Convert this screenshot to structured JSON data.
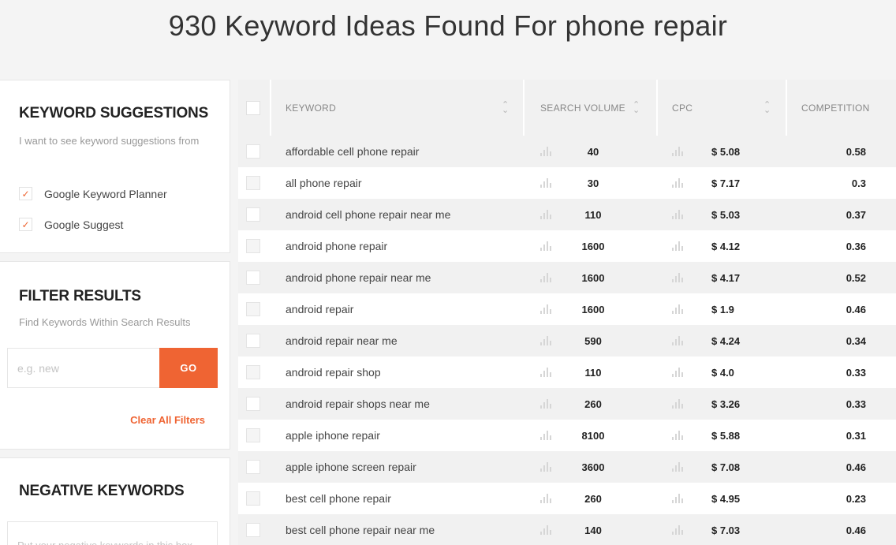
{
  "page": {
    "title": "930 Keyword Ideas Found For phone repair"
  },
  "sidebar": {
    "suggestions": {
      "heading": "KEYWORD SUGGESTIONS",
      "description": "I want to see keyword suggestions from",
      "options": [
        {
          "label": "Google Keyword Planner",
          "checked": true
        },
        {
          "label": "Google Suggest",
          "checked": true
        }
      ]
    },
    "filter": {
      "heading": "FILTER RESULTS",
      "description": "Find Keywords Within Search Results",
      "input_placeholder": "e.g. new",
      "input_value": "",
      "go_label": "GO",
      "clear_label": "Clear All Filters"
    },
    "negative": {
      "heading": "NEGATIVE KEYWORDS",
      "placeholder": "Put your negative keywords in this box"
    }
  },
  "table": {
    "headers": {
      "keyword": "KEYWORD",
      "search_volume": "SEARCH VOLUME",
      "cpc": "CPC",
      "competition": "COMPETITION"
    },
    "rows": [
      {
        "keyword": "affordable cell phone repair",
        "search_volume": "40",
        "cpc": "$ 5.08",
        "competition": "0.58"
      },
      {
        "keyword": "all phone repair",
        "search_volume": "30",
        "cpc": "$ 7.17",
        "competition": "0.3"
      },
      {
        "keyword": "android cell phone repair near me",
        "search_volume": "110",
        "cpc": "$ 5.03",
        "competition": "0.37"
      },
      {
        "keyword": "android phone repair",
        "search_volume": "1600",
        "cpc": "$ 4.12",
        "competition": "0.36"
      },
      {
        "keyword": "android phone repair near me",
        "search_volume": "1600",
        "cpc": "$ 4.17",
        "competition": "0.52"
      },
      {
        "keyword": "android repair",
        "search_volume": "1600",
        "cpc": "$ 1.9",
        "competition": "0.46"
      },
      {
        "keyword": "android repair near me",
        "search_volume": "590",
        "cpc": "$ 4.24",
        "competition": "0.34"
      },
      {
        "keyword": "android repair shop",
        "search_volume": "110",
        "cpc": "$ 4.0",
        "competition": "0.33"
      },
      {
        "keyword": "android repair shops near me",
        "search_volume": "260",
        "cpc": "$ 3.26",
        "competition": "0.33"
      },
      {
        "keyword": "apple iphone repair",
        "search_volume": "8100",
        "cpc": "$ 5.88",
        "competition": "0.31"
      },
      {
        "keyword": "apple iphone screen repair",
        "search_volume": "3600",
        "cpc": "$ 7.08",
        "competition": "0.46"
      },
      {
        "keyword": "best cell phone repair",
        "search_volume": "260",
        "cpc": "$ 4.95",
        "competition": "0.23"
      },
      {
        "keyword": "best cell phone repair near me",
        "search_volume": "140",
        "cpc": "$ 7.03",
        "competition": "0.46"
      }
    ]
  },
  "colors": {
    "accent": "#ef6433",
    "row_alt": "#f1f1f1",
    "text": "#333333"
  },
  "icons": {
    "checkbox_checked": "checkmark-icon",
    "sort": "sort-icon",
    "trend": "bar-chart-icon"
  }
}
